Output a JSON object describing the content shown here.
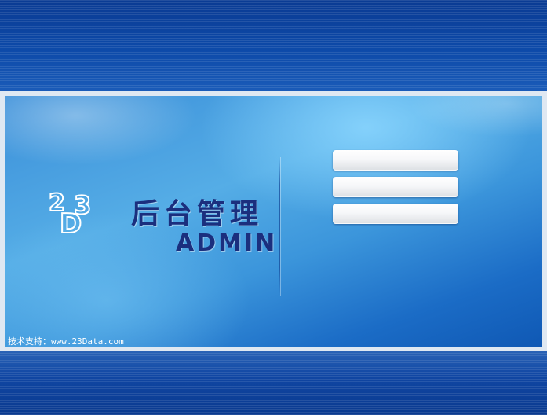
{
  "brand": {
    "logo_text": "23D",
    "title_cn": "后台管理",
    "title_en": "ADMIN"
  },
  "login_form": {
    "username": {
      "value": "",
      "placeholder": ""
    },
    "password": {
      "value": "",
      "placeholder": ""
    },
    "captcha": {
      "value": "",
      "placeholder": ""
    }
  },
  "footer": {
    "support_text": "技术支持：www.23Data.com"
  },
  "colors": {
    "title": "#1b2f7e",
    "band": "#0d4aa9",
    "panel": "#3b95db"
  }
}
